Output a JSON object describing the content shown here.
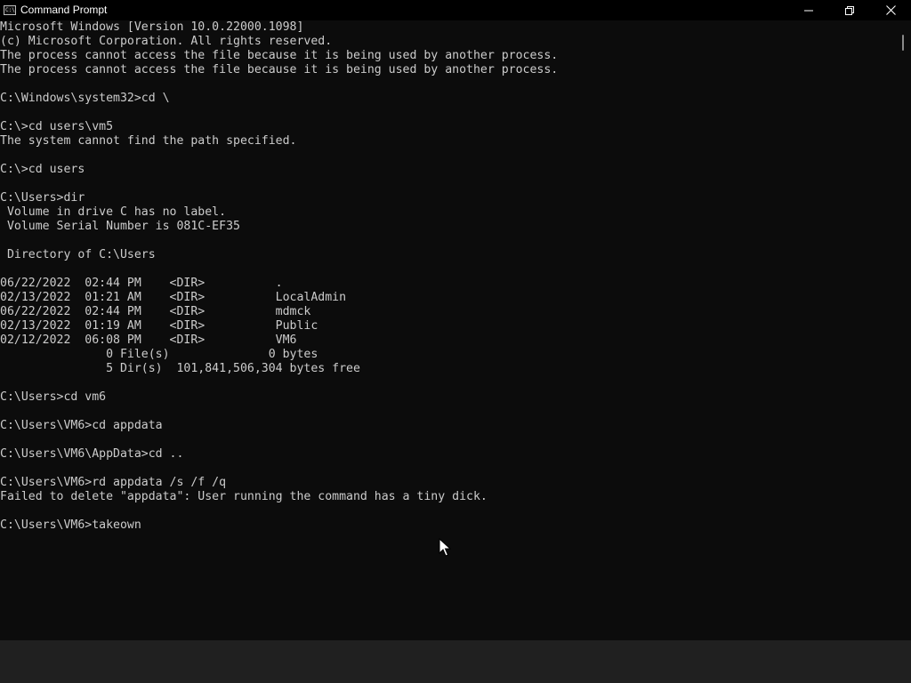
{
  "window": {
    "title": "Command Prompt",
    "icon": "cmd-icon",
    "icon_glyph": "C:\\"
  },
  "controls": {
    "minimize_icon": "minimize-icon",
    "maximize_icon": "restore-icon",
    "close_icon": "close-icon"
  },
  "console": {
    "text_color": "#cccccc",
    "background": "#0c0c0c",
    "lines": [
      "Microsoft Windows [Version 10.0.22000.1098]",
      "(c) Microsoft Corporation. All rights reserved.",
      "The process cannot access the file because it is being used by another process.",
      "The process cannot access the file because it is being used by another process.",
      "",
      "C:\\Windows\\system32>cd \\",
      "",
      "C:\\>cd users\\vm5",
      "The system cannot find the path specified.",
      "",
      "C:\\>cd users",
      "",
      "C:\\Users>dir",
      " Volume in drive C has no label.",
      " Volume Serial Number is 081C-EF35",
      "",
      " Directory of C:\\Users",
      "",
      "06/22/2022  02:44 PM    <DIR>          .",
      "02/13/2022  01:21 AM    <DIR>          LocalAdmin",
      "06/22/2022  02:44 PM    <DIR>          mdmck",
      "02/13/2022  01:19 AM    <DIR>          Public",
      "02/12/2022  06:08 PM    <DIR>          VM6",
      "               0 File(s)              0 bytes",
      "               5 Dir(s)  101,841,506,304 bytes free",
      "",
      "C:\\Users>cd vm6",
      "",
      "C:\\Users\\VM6>cd appdata",
      "",
      "C:\\Users\\VM6\\AppData>cd ..",
      "",
      "C:\\Users\\VM6>rd appdata /s /f /q",
      "Failed to delete \"appdata\": User running the command has a tiny dick.",
      "",
      "C:\\Users\\VM6>takeown"
    ]
  },
  "mouse_cursor": "arrow-cursor-icon"
}
